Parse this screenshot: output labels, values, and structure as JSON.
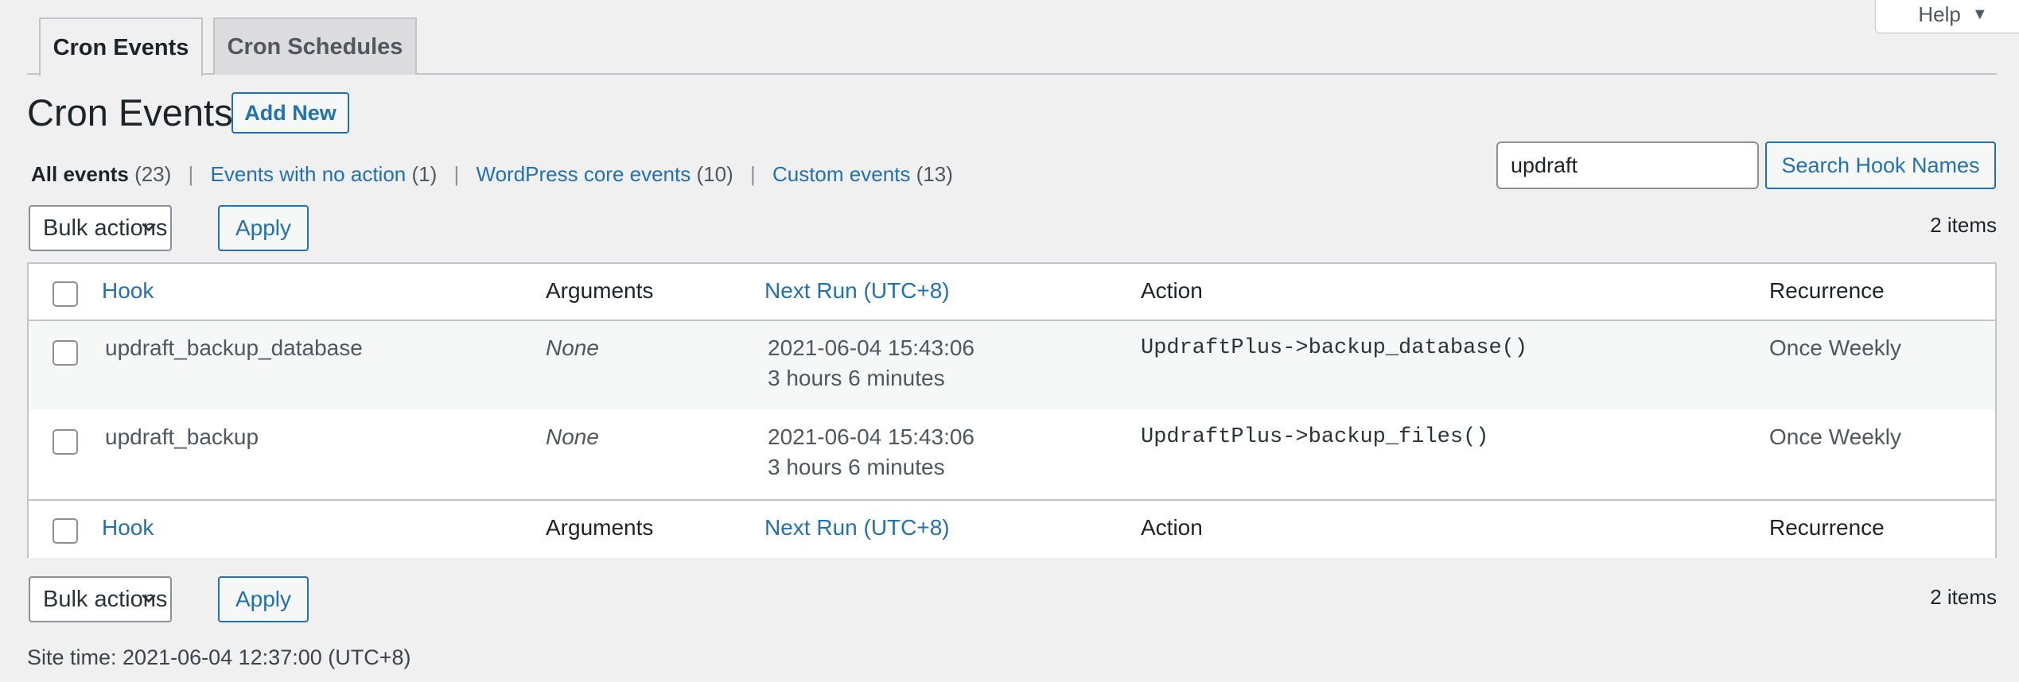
{
  "help": {
    "label": "Help"
  },
  "tabs": [
    {
      "label": "Cron Events"
    },
    {
      "label": "Cron Schedules"
    }
  ],
  "page_title": "Cron Events",
  "add_new_label": "Add New",
  "views": [
    {
      "label": "All events",
      "count": "(23)"
    },
    {
      "label": "Events with no action",
      "count": "(1)"
    },
    {
      "label": "WordPress core events",
      "count": "(10)"
    },
    {
      "label": "Custom events",
      "count": "(13)"
    }
  ],
  "search": {
    "value": "updraft",
    "button_label": "Search Hook Names"
  },
  "bulk": {
    "select_label": "Bulk actions",
    "apply_label": "Apply"
  },
  "items_count": "2 items",
  "columns": {
    "hook": "Hook",
    "arguments": "Arguments",
    "next_run": "Next Run (UTC+8)",
    "action": "Action",
    "recurrence": "Recurrence"
  },
  "rows": [
    {
      "hook": "updraft_backup_database",
      "arguments": "None",
      "next_run_time": "2021-06-04 15:43:06",
      "next_run_relative": "3 hours 6 minutes",
      "action": "UpdraftPlus->backup_database()",
      "recurrence": "Once Weekly"
    },
    {
      "hook": "updraft_backup",
      "arguments": "None",
      "next_run_time": "2021-06-04 15:43:06",
      "next_run_relative": "3 hours 6 minutes",
      "action": "UpdraftPlus->backup_files()",
      "recurrence": "Once Weekly"
    }
  ],
  "site_time": "Site time: 2021-06-04 12:37:00 (UTC+8)"
}
